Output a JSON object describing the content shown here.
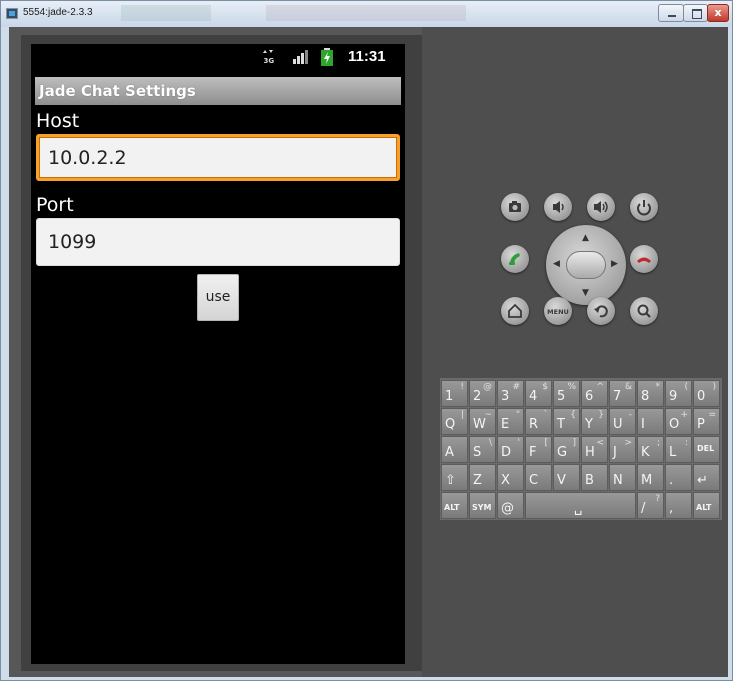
{
  "window": {
    "title": "5554:jade-2.3.3",
    "controls": {
      "close": "x"
    }
  },
  "status_bar": {
    "network": "3G",
    "time": "11:31"
  },
  "app": {
    "title": "Jade Chat Settings",
    "host_label": "Host",
    "host_value": "10.0.2.2",
    "port_label": "Port",
    "port_value": "1099",
    "use_button": "use"
  },
  "hardware_buttons": [
    "camera-icon",
    "volume-down-icon",
    "volume-up-icon",
    "power-icon",
    "call-icon",
    "dpad",
    "end-call-icon",
    "home-icon",
    "menu-icon",
    "back-icon",
    "search-icon"
  ],
  "hardware_labels": {
    "menu": "MENU"
  },
  "keyboard": {
    "row1": [
      {
        "m": "1",
        "s": "!"
      },
      {
        "m": "2",
        "s": "@"
      },
      {
        "m": "3",
        "s": "#"
      },
      {
        "m": "4",
        "s": "$"
      },
      {
        "m": "5",
        "s": "%"
      },
      {
        "m": "6",
        "s": "^"
      },
      {
        "m": "7",
        "s": "&"
      },
      {
        "m": "8",
        "s": "*"
      },
      {
        "m": "9",
        "s": "("
      },
      {
        "m": "0",
        "s": ")"
      }
    ],
    "row2": [
      {
        "m": "Q",
        "s": "|"
      },
      {
        "m": "W",
        "s": "~"
      },
      {
        "m": "E",
        "s": "\""
      },
      {
        "m": "R",
        "s": "`"
      },
      {
        "m": "T",
        "s": "{"
      },
      {
        "m": "Y",
        "s": "}"
      },
      {
        "m": "U",
        "s": "-"
      },
      {
        "m": "I",
        "s": ""
      },
      {
        "m": "O",
        "s": "+"
      },
      {
        "m": "P",
        "s": "="
      }
    ],
    "row3": [
      {
        "m": "A",
        "s": ""
      },
      {
        "m": "S",
        "s": "\\"
      },
      {
        "m": "D",
        "s": "'"
      },
      {
        "m": "F",
        "s": "["
      },
      {
        "m": "G",
        "s": "]"
      },
      {
        "m": "H",
        "s": "<"
      },
      {
        "m": "J",
        "s": ">"
      },
      {
        "m": "K",
        "s": ";"
      },
      {
        "m": "L",
        "s": ":"
      },
      {
        "m": "DEL",
        "s": ""
      }
    ],
    "row4": [
      {
        "m": "⇧",
        "s": ""
      },
      {
        "m": "Z",
        "s": ""
      },
      {
        "m": "X",
        "s": ""
      },
      {
        "m": "C",
        "s": ""
      },
      {
        "m": "V",
        "s": ""
      },
      {
        "m": "B",
        "s": ""
      },
      {
        "m": "N",
        "s": ""
      },
      {
        "m": "M",
        "s": ""
      },
      {
        "m": ".",
        "s": ""
      },
      {
        "m": "↵",
        "s": ""
      }
    ],
    "row5": [
      {
        "m": "ALT",
        "s": ""
      },
      {
        "m": "SYM",
        "s": ""
      },
      {
        "m": "@",
        "s": ""
      },
      {
        "m": "␣",
        "s": ""
      },
      {
        "m": "/",
        "s": "?"
      },
      {
        "m": ",",
        "s": ""
      },
      {
        "m": "ALT",
        "s": ""
      }
    ]
  }
}
